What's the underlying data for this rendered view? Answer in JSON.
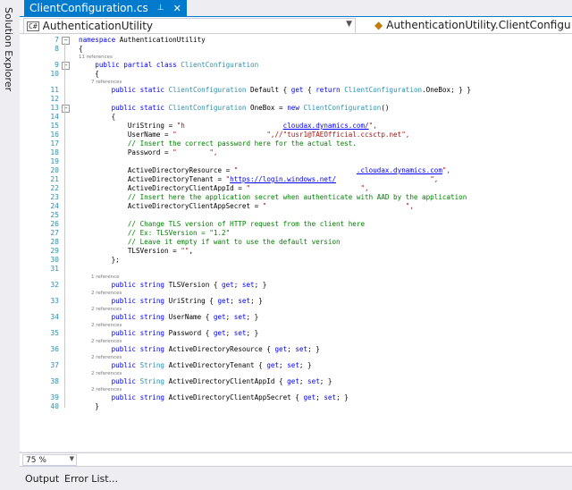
{
  "side_panel": {
    "label": "Solution Explorer"
  },
  "tab": {
    "title": "ClientConfiguration.cs",
    "close_glyph": "✕",
    "pin_glyph": "⊥"
  },
  "nav": {
    "project": "AuthenticationUtility",
    "project_icon": "C#",
    "member": "AuthenticationUtility.ClientConfiguration"
  },
  "zoom": {
    "value": "75 %"
  },
  "bottom_tabs": [
    "Output",
    "Error List..."
  ],
  "colors": {
    "accent": "#007acc",
    "keyword": "#0000ff",
    "type": "#2b91af",
    "string": "#a31515",
    "comment": "#008000"
  },
  "code": [
    {
      "ln": "7",
      "fold": "⊟",
      "toks": [
        {
          "t": "namespace ",
          "c": "kw"
        },
        {
          "t": "AuthenticationUtility",
          "c": ""
        }
      ]
    },
    {
      "ln": "8",
      "toks": [
        {
          "t": "{",
          "c": ""
        }
      ]
    },
    {
      "ref": "11 references"
    },
    {
      "ln": "9",
      "fold": "⊟",
      "toks": [
        {
          "t": "    public partial class ",
          "c": "kw"
        },
        {
          "t": "ClientConfiguration",
          "c": "ty"
        }
      ]
    },
    {
      "ln": "10",
      "toks": [
        {
          "t": "    {",
          "c": ""
        }
      ]
    },
    {
      "ref": "        7 references"
    },
    {
      "ln": "11",
      "toks": [
        {
          "t": "        public static ",
          "c": "kw"
        },
        {
          "t": "ClientConfiguration",
          "c": "ty"
        },
        {
          "t": " Default { ",
          "c": ""
        },
        {
          "t": "get",
          "c": "kw"
        },
        {
          "t": " { ",
          "c": ""
        },
        {
          "t": "return ",
          "c": "kw"
        },
        {
          "t": "ClientConfiguration",
          "c": "ty"
        },
        {
          "t": ".OneBox; } }",
          "c": ""
        }
      ]
    },
    {
      "ln": "12",
      "toks": []
    },
    {
      "ln": "13",
      "fold": "⊟",
      "toks": [
        {
          "t": "        public static ",
          "c": "kw"
        },
        {
          "t": "ClientConfiguration",
          "c": "ty"
        },
        {
          "t": " OneBox = ",
          "c": ""
        },
        {
          "t": "new ",
          "c": "kw"
        },
        {
          "t": "ClientConfiguration",
          "c": "ty"
        },
        {
          "t": "()",
          "c": ""
        }
      ]
    },
    {
      "ln": "14",
      "toks": [
        {
          "t": "        {",
          "c": ""
        }
      ]
    },
    {
      "ln": "15",
      "toks": [
        {
          "t": "            UriString = ",
          "c": ""
        },
        {
          "t": "\"h",
          "c": "st"
        },
        {
          "t": "                        ",
          "c": "redact"
        },
        {
          "t": "cloudax.dynamics.com/",
          "c": "lk"
        },
        {
          "t": "\",",
          "c": "st"
        }
      ]
    },
    {
      "ln": "16",
      "toks": [
        {
          "t": "            UserName = ",
          "c": ""
        },
        {
          "t": "\"",
          "c": "st"
        },
        {
          "t": "                      ",
          "c": "redact"
        },
        {
          "t": "\",//\"tusr1@TAEOfficial.ccsctp.net\",",
          "c": "st"
        }
      ]
    },
    {
      "ln": "17",
      "toks": [
        {
          "t": "            // Insert the correct password here for the actual test.",
          "c": "cm"
        }
      ]
    },
    {
      "ln": "18",
      "toks": [
        {
          "t": "            Password = ",
          "c": ""
        },
        {
          "t": "\"",
          "c": "st"
        },
        {
          "t": "        ",
          "c": "redact"
        },
        {
          "t": "\",",
          "c": "st"
        }
      ]
    },
    {
      "ln": "19",
      "toks": []
    },
    {
      "ln": "20",
      "toks": [
        {
          "t": "            ActiveDirectoryResource = ",
          "c": ""
        },
        {
          "t": "\"",
          "c": "st"
        },
        {
          "t": "                             ",
          "c": "redact"
        },
        {
          "t": ".cloudax.dynamics.com",
          "c": "lk"
        },
        {
          "t": "\",",
          "c": "st"
        }
      ]
    },
    {
      "ln": "21",
      "toks": [
        {
          "t": "            ActiveDirectoryTenant = ",
          "c": ""
        },
        {
          "t": "\"",
          "c": "st"
        },
        {
          "t": "https://login.windows.net/",
          "c": "lk"
        },
        {
          "t": "                       ",
          "c": "redact"
        },
        {
          "t": "\",",
          "c": "st"
        }
      ]
    },
    {
      "ln": "22",
      "toks": [
        {
          "t": "            ActiveDirectoryClientAppId = ",
          "c": ""
        },
        {
          "t": "\"",
          "c": "st"
        },
        {
          "t": "                           ",
          "c": "redact"
        },
        {
          "t": "\",",
          "c": "st"
        }
      ]
    },
    {
      "ln": "23",
      "toks": [
        {
          "t": "            // Insert here the application secret when authenticate with AAD by the application",
          "c": "cm"
        }
      ]
    },
    {
      "ln": "24",
      "toks": [
        {
          "t": "            ActiveDirectoryClientAppSecret = ",
          "c": ""
        },
        {
          "t": "\"",
          "c": "st"
        },
        {
          "t": "                                  ",
          "c": "redact"
        },
        {
          "t": "\",",
          "c": "st"
        }
      ]
    },
    {
      "ln": "25",
      "toks": []
    },
    {
      "ln": "26",
      "toks": [
        {
          "t": "            // Change TLS version of HTTP request from the client here",
          "c": "cm"
        }
      ]
    },
    {
      "ln": "27",
      "toks": [
        {
          "t": "            // Ex: TLSVersion = \"1.2\"",
          "c": "cm"
        }
      ]
    },
    {
      "ln": "28",
      "toks": [
        {
          "t": "            // Leave it empty if want to use the default version",
          "c": "cm"
        }
      ]
    },
    {
      "ln": "29",
      "toks": [
        {
          "t": "            TLSVersion = ",
          "c": ""
        },
        {
          "t": "\"\"",
          "c": "st"
        },
        {
          "t": ",",
          "c": ""
        }
      ]
    },
    {
      "ln": "30",
      "toks": [
        {
          "t": "        };",
          "c": ""
        }
      ]
    },
    {
      "ln": "31",
      "toks": []
    },
    {
      "ref": "        1 reference"
    },
    {
      "ln": "32",
      "toks": [
        {
          "t": "        public string ",
          "c": "kw"
        },
        {
          "t": "TLSVersion { ",
          "c": ""
        },
        {
          "t": "get",
          "c": "kw"
        },
        {
          "t": "; ",
          "c": ""
        },
        {
          "t": "set",
          "c": "kw"
        },
        {
          "t": "; }",
          "c": ""
        }
      ]
    },
    {
      "ref": "        2 references"
    },
    {
      "ln": "33",
      "toks": [
        {
          "t": "        public string ",
          "c": "kw"
        },
        {
          "t": "UriString { ",
          "c": ""
        },
        {
          "t": "get",
          "c": "kw"
        },
        {
          "t": "; ",
          "c": ""
        },
        {
          "t": "set",
          "c": "kw"
        },
        {
          "t": "; }",
          "c": ""
        }
      ]
    },
    {
      "ref": "        2 references"
    },
    {
      "ln": "34",
      "toks": [
        {
          "t": "        public string ",
          "c": "kw"
        },
        {
          "t": "UserName { ",
          "c": ""
        },
        {
          "t": "get",
          "c": "kw"
        },
        {
          "t": "; ",
          "c": ""
        },
        {
          "t": "set",
          "c": "kw"
        },
        {
          "t": "; }",
          "c": ""
        }
      ]
    },
    {
      "ref": "        2 references"
    },
    {
      "ln": "35",
      "toks": [
        {
          "t": "        public string ",
          "c": "kw"
        },
        {
          "t": "Password { ",
          "c": ""
        },
        {
          "t": "get",
          "c": "kw"
        },
        {
          "t": "; ",
          "c": ""
        },
        {
          "t": "set",
          "c": "kw"
        },
        {
          "t": "; }",
          "c": ""
        }
      ]
    },
    {
      "ref": "        2 references"
    },
    {
      "ln": "36",
      "toks": [
        {
          "t": "        public string ",
          "c": "kw"
        },
        {
          "t": "ActiveDirectoryResource { ",
          "c": ""
        },
        {
          "t": "get",
          "c": "kw"
        },
        {
          "t": "; ",
          "c": ""
        },
        {
          "t": "set",
          "c": "kw"
        },
        {
          "t": "; }",
          "c": ""
        }
      ]
    },
    {
      "ref": "        2 references"
    },
    {
      "ln": "37",
      "toks": [
        {
          "t": "        public ",
          "c": "kw"
        },
        {
          "t": "String",
          "c": "ty"
        },
        {
          "t": " ActiveDirectoryTenant { ",
          "c": ""
        },
        {
          "t": "get",
          "c": "kw"
        },
        {
          "t": "; ",
          "c": ""
        },
        {
          "t": "set",
          "c": "kw"
        },
        {
          "t": "; }",
          "c": ""
        }
      ]
    },
    {
      "ref": "        2 references"
    },
    {
      "ln": "38",
      "toks": [
        {
          "t": "        public ",
          "c": "kw"
        },
        {
          "t": "String",
          "c": "ty"
        },
        {
          "t": " ActiveDirectoryClientAppId { ",
          "c": ""
        },
        {
          "t": "get",
          "c": "kw"
        },
        {
          "t": "; ",
          "c": ""
        },
        {
          "t": "set",
          "c": "kw"
        },
        {
          "t": "; }",
          "c": ""
        }
      ]
    },
    {
      "ref": "        2 references"
    },
    {
      "ln": "39",
      "toks": [
        {
          "t": "        public string ",
          "c": "kw"
        },
        {
          "t": "ActiveDirectoryClientAppSecret { ",
          "c": ""
        },
        {
          "t": "get",
          "c": "kw"
        },
        {
          "t": "; ",
          "c": ""
        },
        {
          "t": "set",
          "c": "kw"
        },
        {
          "t": "; }",
          "c": ""
        }
      ]
    },
    {
      "ln": "40",
      "toks": [
        {
          "t": "    }",
          "c": ""
        }
      ]
    }
  ]
}
